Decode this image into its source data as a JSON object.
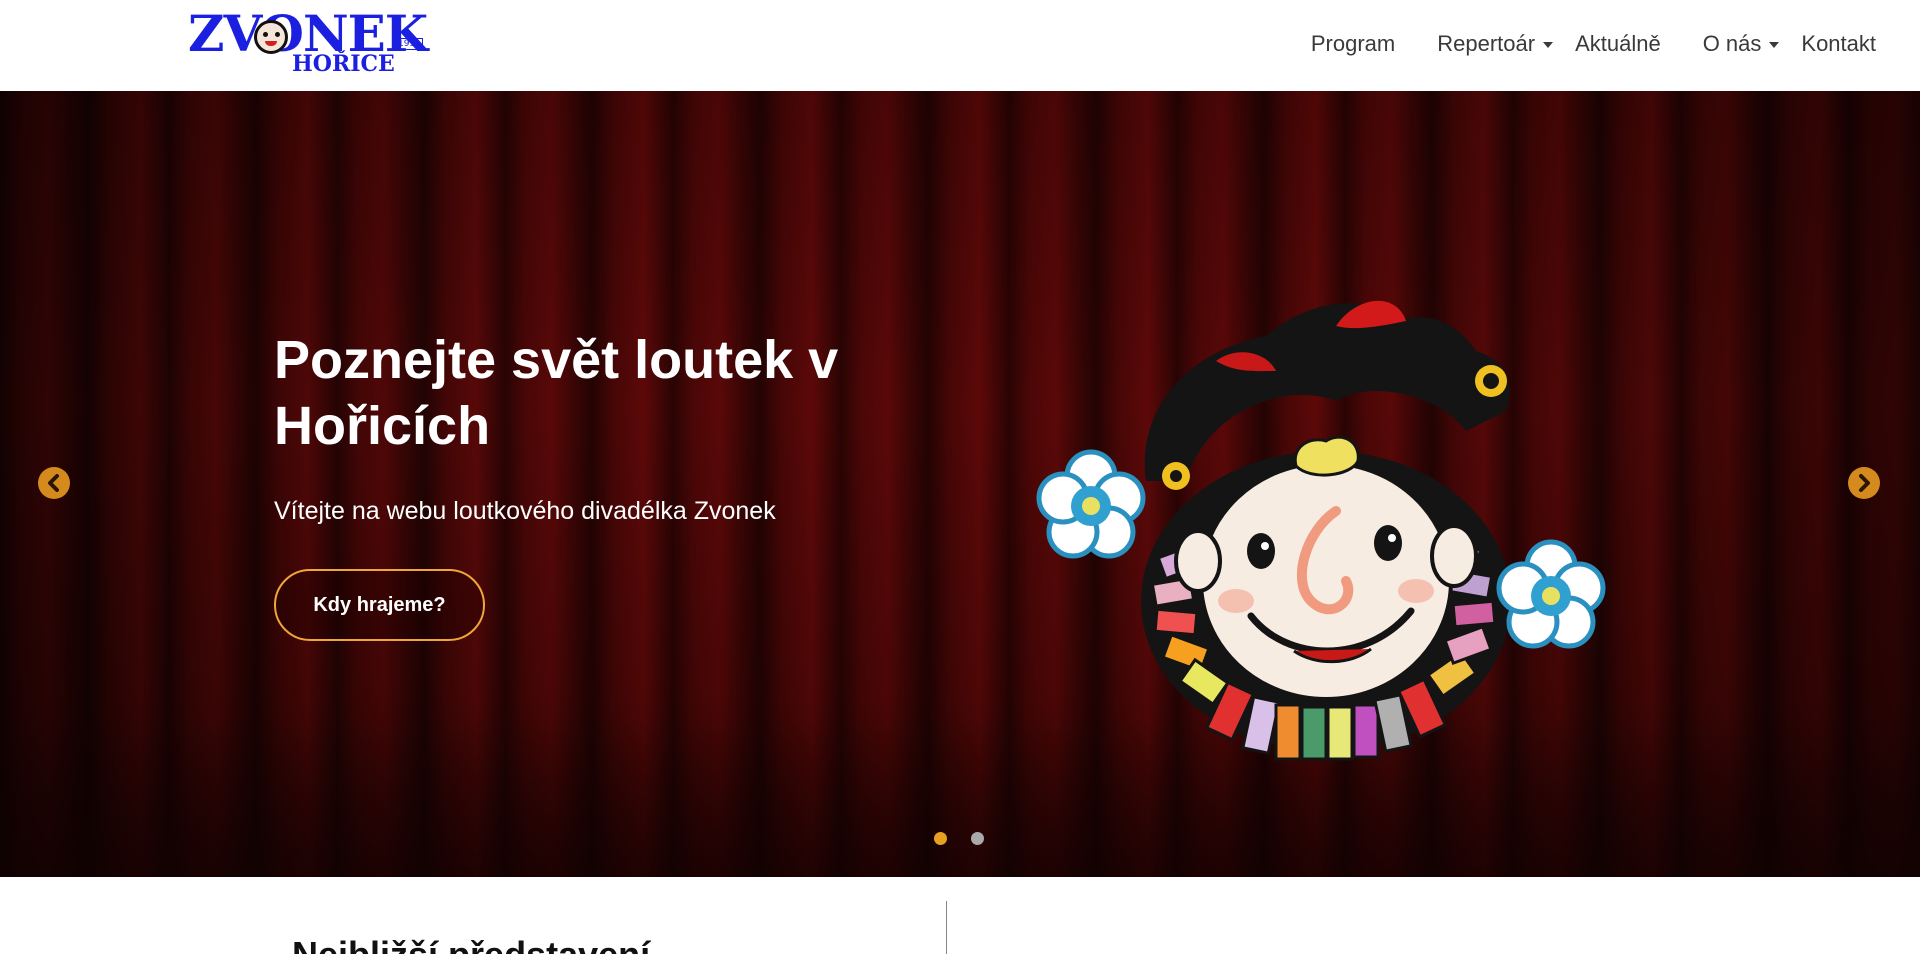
{
  "logo": {
    "line1": "ZVONEK",
    "line2": "HOŘICE",
    "badge": "1931"
  },
  "nav": {
    "items": [
      {
        "label": "Program",
        "dropdown": false
      },
      {
        "label": "Repertoár",
        "dropdown": true
      },
      {
        "label": "Aktuálně",
        "dropdown": false
      },
      {
        "label": "O nás",
        "dropdown": true
      },
      {
        "label": "Kontakt",
        "dropdown": false
      }
    ]
  },
  "hero": {
    "title": "Poznejte svět loutek v Hořicích",
    "subtitle": "Vítejte na webu loutkového divadélka Zvonek",
    "button_label": "Kdy hrajeme?",
    "slides_count": 2,
    "active_slide": 1,
    "colors": {
      "accent": "#d48a1c",
      "button_border": "#f0a63a",
      "dot_active": "#e8a020",
      "dot_inactive": "#aaaaaa",
      "curtain": "#5a0808"
    },
    "icons": {
      "prev": "chevron-left-circle-icon",
      "next": "chevron-right-circle-icon",
      "image": "jester-puppet-illustration"
    }
  },
  "section": {
    "title": "Nejbližší představení"
  }
}
